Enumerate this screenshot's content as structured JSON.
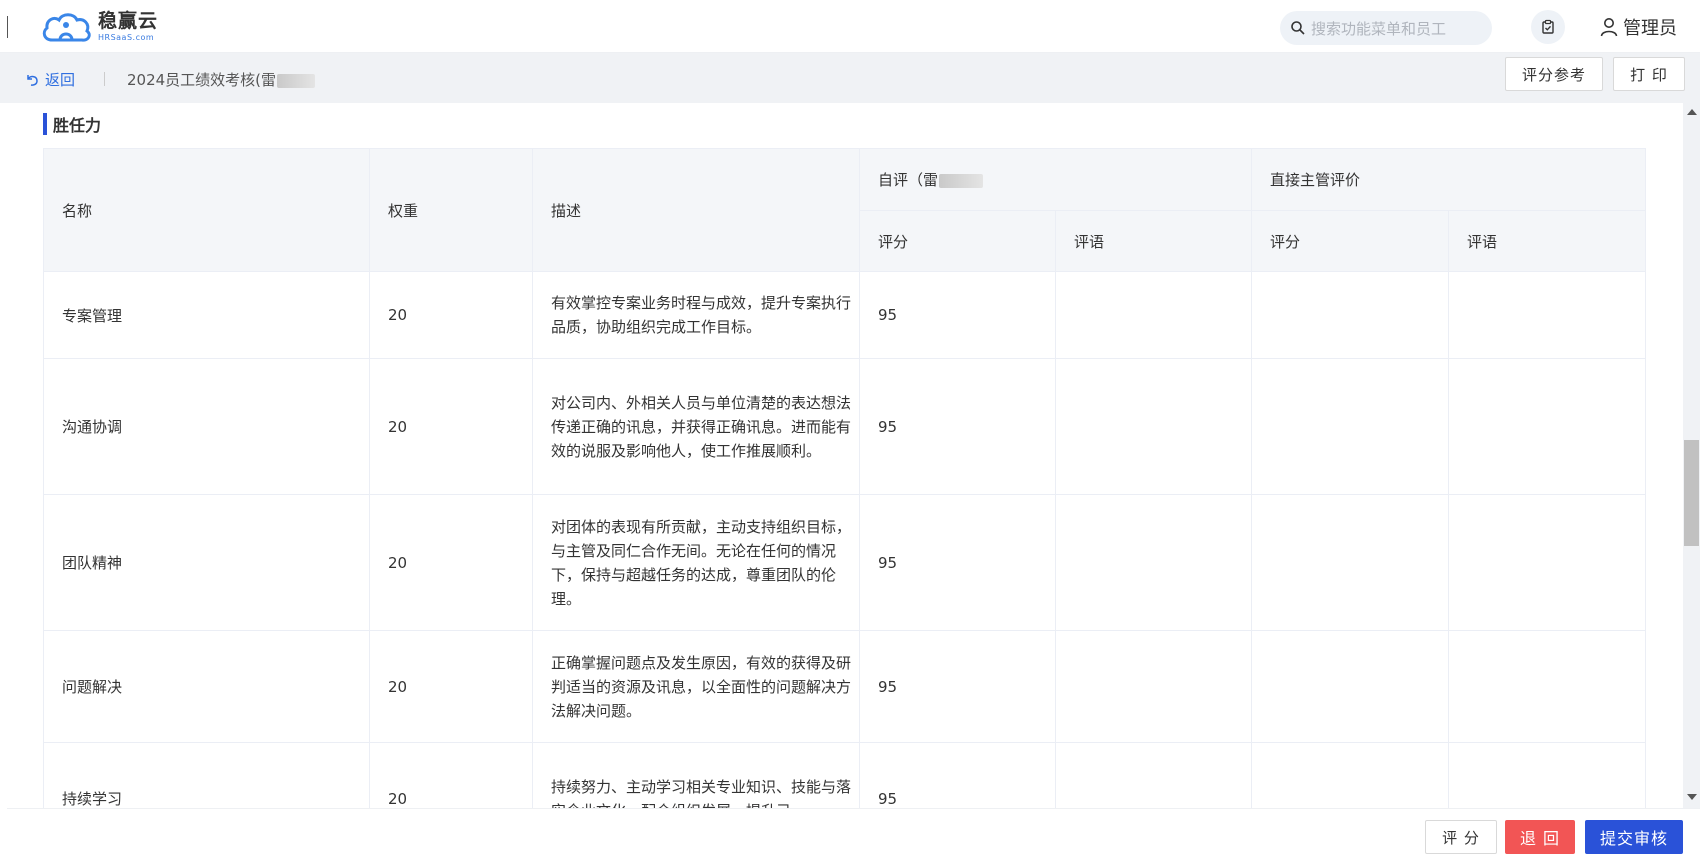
{
  "header": {
    "logo_name": "稳赢云",
    "logo_sub": "HRSaaS.com",
    "search_placeholder": "搜索功能菜单和员工",
    "user_label": "管理员"
  },
  "subbar": {
    "back_label": "返回",
    "breadcrumb": "2024员工绩效考核(雷",
    "score_reference_label": "评分参考",
    "print_label": "打 印"
  },
  "section": {
    "title": "胜任力",
    "columns": {
      "name": "名称",
      "weight": "权重",
      "description": "描述",
      "self_eval": "自评（雷",
      "manager_eval": "直接主管评价",
      "score": "评分",
      "comment": "评语"
    },
    "rows": [
      {
        "name": "专案管理",
        "weight": "20",
        "description": "有效掌控专案业务时程与成效，提升专案执行品质，协助组织完成工作目标。",
        "self_score": "95"
      },
      {
        "name": "沟通协调",
        "weight": "20",
        "description": "对公司内、外相关人员与单位清楚的表达想法传递正确的讯息，并获得正确讯息。进而能有效的说服及影响他人，使工作推展顺利。",
        "self_score": "95"
      },
      {
        "name": "团队精神",
        "weight": "20",
        "description": "对团体的表现有所贡献，主动支持组织目标，与主管及同仁合作无间。无论在任何的情况下，保持与超越任务的达成，尊重团队的伦理。",
        "self_score": "95"
      },
      {
        "name": "问题解决",
        "weight": "20",
        "description": "正确掌握问题点及发生原因，有效的获得及研判适当的资源及讯息，以全面性的问题解决方法解决问题。",
        "self_score": "95"
      },
      {
        "name": "持续学习",
        "weight": "20",
        "description": "持续努力、主动学习相关专业知识、技能与落实企业文化，配合组织发展，提升己",
        "self_score": "95"
      }
    ]
  },
  "footer": {
    "score_label": "评 分",
    "return_label": "退 回",
    "submit_label": "提交审核"
  },
  "colors": {
    "primary": "#2a52d8",
    "danger": "#f25555",
    "link": "#2f6fe0",
    "header_bg": "#f4f6f9",
    "page_bg": "#f0f2f5"
  }
}
